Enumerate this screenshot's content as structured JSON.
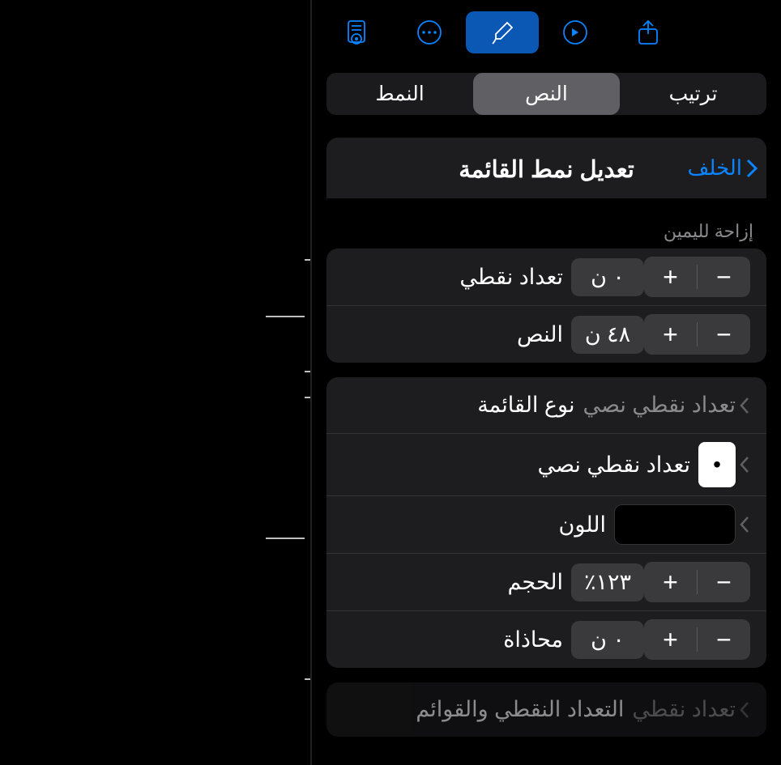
{
  "toolbar": {
    "icons": [
      "document-view-icon",
      "more-icon",
      "format-icon",
      "redo-icon",
      "share-icon"
    ]
  },
  "segments": {
    "style": "النمط",
    "text": "النص",
    "arrange": "ترتيب"
  },
  "header": {
    "back": "الخلف",
    "title": "تعديل نمط القائمة"
  },
  "indent": {
    "section_label": "إزاحة لليمين",
    "bullet_label": "تعداد نقطي",
    "bullet_value": "٠ ن",
    "text_label": "النص",
    "text_value": "٤٨ ن"
  },
  "list": {
    "type_label": "نوع القائمة",
    "type_value": "تعداد نقطي نصي",
    "bullet_char_label": "تعداد نقطي نصي",
    "bullet_char": "•",
    "color_label": "اللون",
    "color_value": "#000000",
    "size_label": "الحجم",
    "size_value": "١٢٣٪",
    "align_label": "محاذاة",
    "align_value": "٠ ن"
  },
  "footer": {
    "label": "التعداد النقطي والقوائم",
    "value": "تعداد نقطي"
  },
  "glyphs": {
    "plus": "+",
    "minus": "−"
  }
}
